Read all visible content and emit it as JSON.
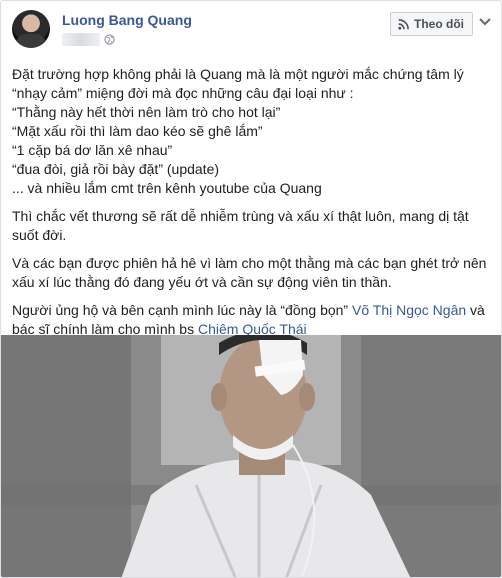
{
  "post": {
    "author": "Luong Bang Quang",
    "follow_label": "Theo dõi",
    "icons": {
      "visibility": "globe-icon",
      "follow": "rss-icon",
      "more": "chevron-down-icon"
    },
    "paragraphs": [
      [
        "Đặt trường hợp không phải là Quang mà là một người mắc chứng tâm lý",
        "“nhạy cảm” miệng đời mà đọc những câu đại loại như :",
        "“Thằng này hết thời nên làm trò cho hot lại”",
        "“Mặt xấu rồi thì làm dao kéo sẽ ghê lắm”",
        "“1 cặp bá dơ lăn xê nhau”",
        "“đua đòi, giả rồi bày đặt” (update)",
        "... và nhiều lắm cmt trên kênh youtube của Quang"
      ],
      [
        "Thì chắc vết thương sẽ rất dễ nhiễm trùng và xấu xí thật luôn, mang dị tật",
        "suốt đời."
      ],
      [
        "Và các bạn được phiên hả hê vì làm cho một thằng mà các bạn ghét trở nên",
        "xấu xí lúc thằng đó đang yếu ớt và cần sự động viên tin thần."
      ]
    ],
    "mention_paragraph": {
      "line1_text": "Người ủng hộ và bên cạnh mình lúc này là “đồng bọn” ",
      "line1_link": "Võ Thị Ngọc Ngân",
      "line1_tail": " và",
      "line2_text": "bác sĩ chính làm cho mình bs ",
      "line2_link": "Chiêm Quốc Thái"
    },
    "colors": {
      "name_link": "#385898",
      "text": "#1c1e21"
    }
  }
}
